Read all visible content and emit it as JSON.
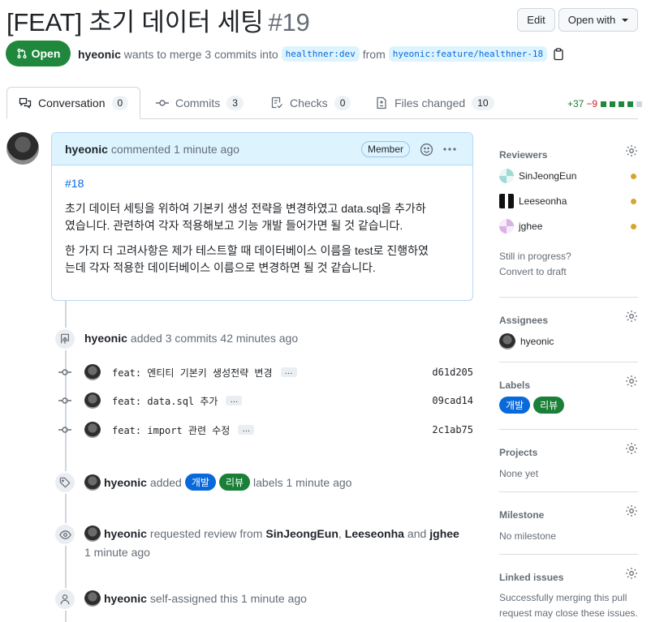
{
  "header": {
    "title": "[FEAT] 초기 데이터 세팅",
    "number": "#19",
    "edit_label": "Edit",
    "open_with_label": "Open with"
  },
  "state": {
    "label": "Open",
    "color": "#1f883d"
  },
  "meta": {
    "author": "hyeonic",
    "text_merge": "wants to merge 3 commits into",
    "base_branch": "healthner:dev",
    "text_from": "from",
    "head_branch": "hyeonic:feature/healthner-18"
  },
  "tabs": [
    {
      "label": "Conversation",
      "count": "0",
      "icon": "comment-discussion-icon"
    },
    {
      "label": "Commits",
      "count": "3",
      "icon": "git-commit-icon"
    },
    {
      "label": "Checks",
      "count": "0",
      "icon": "checklist-icon"
    },
    {
      "label": "Files changed",
      "count": "10",
      "icon": "file-diff-icon"
    }
  ],
  "diffstat": {
    "additions": "+37",
    "deletions": "−9"
  },
  "comment": {
    "author": "hyeonic",
    "action": "commented 1 minute ago",
    "badge": "Member",
    "issue_ref": "#18",
    "paragraph1_line1": "초기 데이터 세팅을 위하여 기본키 생성 전략을 변경하였고 data.sql을 추가하",
    "paragraph1_line2": "였습니다. 관련하여 각자 적용해보고 기능 개발 들어가면 될 것 같습니다.",
    "paragraph2_line1": "한 가지 더 고려사항은 제가 테스트할 때 데이터베이스 이름을 test로 진행하였",
    "paragraph2_line2": "는데 각자 적용한 데이터베이스 이름으로 변경하면 될 것 같습니다."
  },
  "timeline": {
    "commits_event": {
      "author": "hyeonic",
      "text": "added 3 commits 42 minutes ago"
    },
    "commits": [
      {
        "message": "feat: 엔티티 기본키 생성전략 변경",
        "sha": "d61d205"
      },
      {
        "message": "feat: data.sql 추가",
        "sha": "09cad14"
      },
      {
        "message": "feat: import 관련 수정",
        "sha": "2c1ab75"
      }
    ],
    "labels_event": {
      "author": "hyeonic",
      "text_added": "added",
      "text_after": "labels 1 minute ago"
    },
    "review_event": {
      "author": "hyeonic",
      "text": "requested review from",
      "reviewer1": "SinJeongEun",
      "reviewer2": "Leeseonha",
      "text_and": "and",
      "reviewer3": "jghee",
      "time": "1 minute ago"
    },
    "assign_event": {
      "author": "hyeonic",
      "text": "self-assigned this 1 minute ago"
    }
  },
  "labels": [
    {
      "name": "개발",
      "color": "#0969da"
    },
    {
      "name": "리뷰",
      "color": "#1a7f37"
    }
  ],
  "sidebar": {
    "reviewers_title": "Reviewers",
    "reviewers": [
      {
        "name": "SinJeongEun"
      },
      {
        "name": "Leeseonha"
      },
      {
        "name": "jghee"
      }
    ],
    "still_in_progress": "Still in progress?",
    "convert_to_draft": "Convert to draft",
    "assignees_title": "Assignees",
    "assignee": "hyeonic",
    "labels_title": "Labels",
    "projects_title": "Projects",
    "projects_value": "None yet",
    "milestone_title": "Milestone",
    "milestone_value": "No milestone",
    "linked_title": "Linked issues",
    "linked_line1": "Successfully merging this pull",
    "linked_line2": "request may close these issues."
  }
}
